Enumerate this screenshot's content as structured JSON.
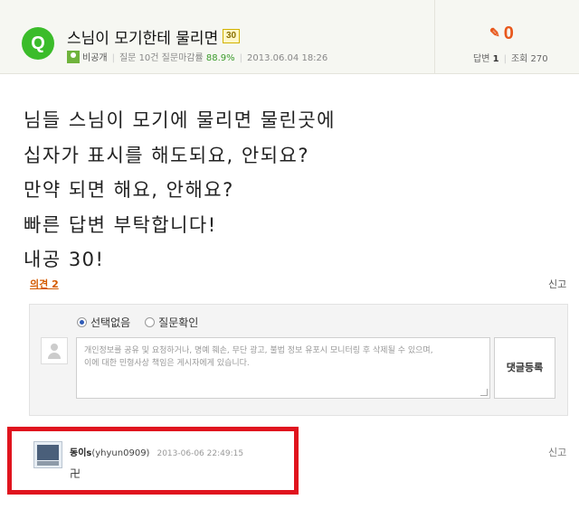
{
  "question": {
    "badge": "Q",
    "title": "스님이 모기한테 물리면",
    "naegong_badge": "30",
    "author": "비공개",
    "stats_text": "질문 10건 질문마감률",
    "close_rate": "88.9%",
    "date": "2013.06.04 18:26"
  },
  "counters": {
    "answer_count": "0",
    "answer_label": "답변",
    "answer_value": "1",
    "view_label": "조회",
    "view_value": "270"
  },
  "body_lines": [
    "님들 스님이 모기에 물리면 물린곳에",
    "십자가 표시를 해도되요, 안되요?",
    "만약 되면 해요, 안해요?",
    "빠른 답변 부탁합니다!",
    "내공 30!"
  ],
  "opinion": {
    "link_label": "의견 2",
    "report_label": "신고",
    "radio_none": "선택없음",
    "radio_confirm": "질문확인",
    "placeholder_line1": "개인정보를 공유 및 요청하거나, 명예 훼손, 무단 광고, 불법 정보 유포시 모니터링 후 삭제될 수 있으며,",
    "placeholder_line2": "이에 대한 민형사상 책임은 게시자에게 있습니다.",
    "submit_label": "댓글등록"
  },
  "reply": {
    "nickname": "동이s",
    "user_id": "(yhyun0909)",
    "date": "2013-06-06 22:49:15",
    "text": "卍",
    "report_label": "신고"
  },
  "colors": {
    "q_badge": "#3bbc2a",
    "answer_count": "#e8581c",
    "highlight_box": "#e0141e",
    "opinion_link": "#d45a00"
  }
}
